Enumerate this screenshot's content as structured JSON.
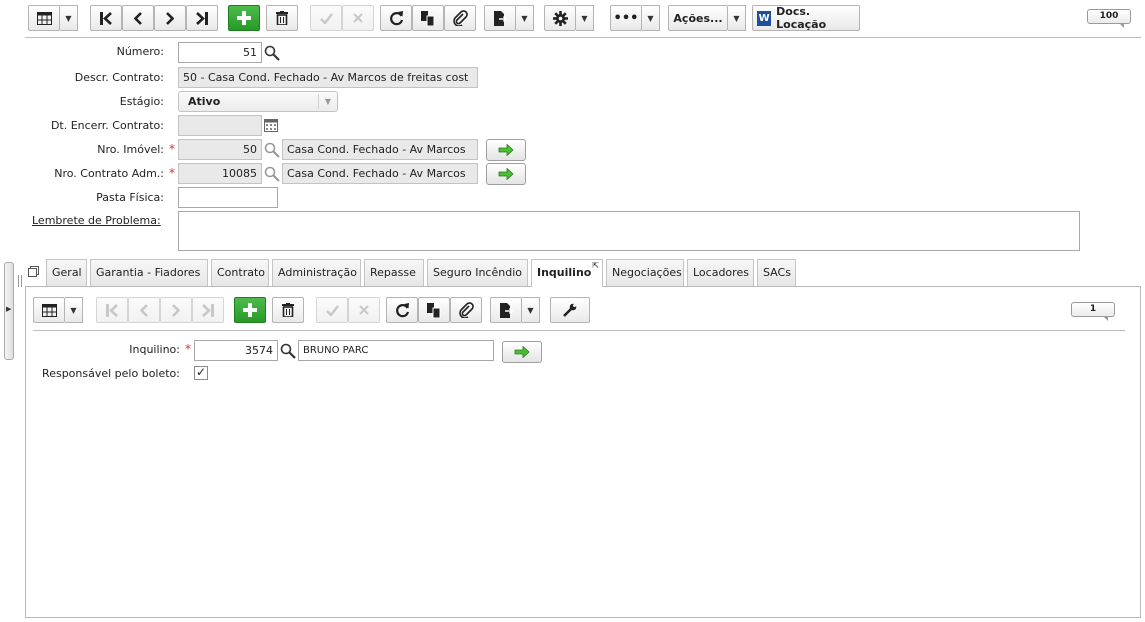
{
  "toolbar": {
    "acoes_label": "Ações...",
    "docs_label": "Docs. Locação",
    "record_count": "100"
  },
  "form": {
    "numero": {
      "label": "Número:",
      "value": "51"
    },
    "descr": {
      "label": "Descr. Contrato:",
      "value": "50 - Casa Cond. Fechado - Av Marcos de freitas cost"
    },
    "estagio": {
      "label": "Estágio:",
      "value": "Ativo"
    },
    "dt_encerr": {
      "label": "Dt. Encerr. Contrato:",
      "value": ""
    },
    "nro_imovel": {
      "label": "Nro. Imóvel:",
      "value": "50",
      "desc": "Casa Cond. Fechado - Av Marcos"
    },
    "nro_contrato_adm": {
      "label": "Nro. Contrato Adm.:",
      "value": "10085",
      "desc": "Casa Cond. Fechado - Av Marcos"
    },
    "pasta_fisica": {
      "label": "Pasta Física:",
      "value": ""
    },
    "lembrete": {
      "label": "Lembrete de Problema:",
      "value": ""
    }
  },
  "tabs": [
    {
      "label": "Geral"
    },
    {
      "label": "Garantia - Fiadores"
    },
    {
      "label": "Contrato"
    },
    {
      "label": "Administração"
    },
    {
      "label": "Repasse"
    },
    {
      "label": "Seguro Incêndio"
    },
    {
      "label": "Inquilino"
    },
    {
      "label": "Negociações"
    },
    {
      "label": "Locadores"
    },
    {
      "label": "SACs"
    }
  ],
  "subpanel": {
    "record_count": "1",
    "inquilino": {
      "label": "Inquilino:",
      "value": "3574",
      "desc": "BRUNO PARC"
    },
    "responsavel": {
      "label": "Responsável pelo boleto:",
      "checked": "✓"
    }
  },
  "icons": [
    "grid-icon",
    "first-record-icon",
    "prev-record-icon",
    "next-record-icon",
    "last-record-icon",
    "add-icon",
    "delete-icon",
    "save-icon",
    "cancel-icon",
    "refresh-icon",
    "copy-icon",
    "attach-icon",
    "report-icon",
    "gear-icon",
    "more-icon",
    "word-icon",
    "search-icon",
    "calendar-icon",
    "arrow-right-icon",
    "wrench-icon"
  ],
  "colors": {
    "accent_green": "#2f9e2f",
    "required": "#dd3333",
    "go_arrow": "#3fae2a"
  }
}
